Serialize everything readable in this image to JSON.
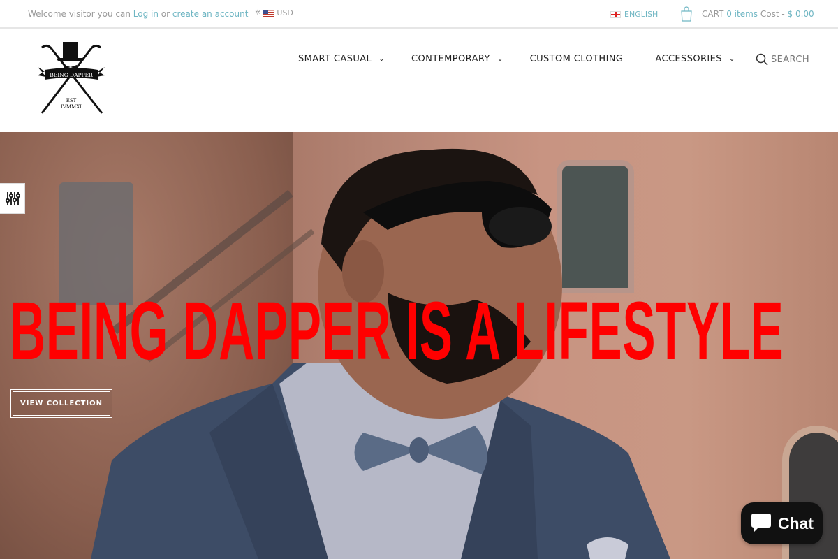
{
  "topbar": {
    "welcome_prefix": "Welcome visitor you can",
    "login_link": "Log in",
    "or_text": "or",
    "create_account_link": "create an account",
    "currency": "USD",
    "language": "ENGLISH",
    "cart_label": "CART",
    "cart_items": "0 items",
    "cart_cost_label": "Cost -",
    "cart_cost": "$ 0.00"
  },
  "logo": {
    "banner_text": "BEING DAPPER",
    "est_line1": "EST",
    "est_line2": "IVMMXI"
  },
  "nav": {
    "items": [
      {
        "label": "SMART CASUAL",
        "has_dropdown": true
      },
      {
        "label": "CONTEMPORARY",
        "has_dropdown": true
      },
      {
        "label": "CUSTOM CLOTHING",
        "has_dropdown": false
      },
      {
        "label": "ACCESSORIES",
        "has_dropdown": true
      }
    ],
    "search_label": "SEARCH"
  },
  "hero": {
    "headline": "BEING DAPPER IS A LIFESTYLE",
    "cta_label": "VIEW COLLECTION",
    "headline_color": "#ff0000"
  },
  "chat": {
    "label": "Chat"
  },
  "colors": {
    "accent": "#6fb6c3",
    "text": "#222222"
  }
}
